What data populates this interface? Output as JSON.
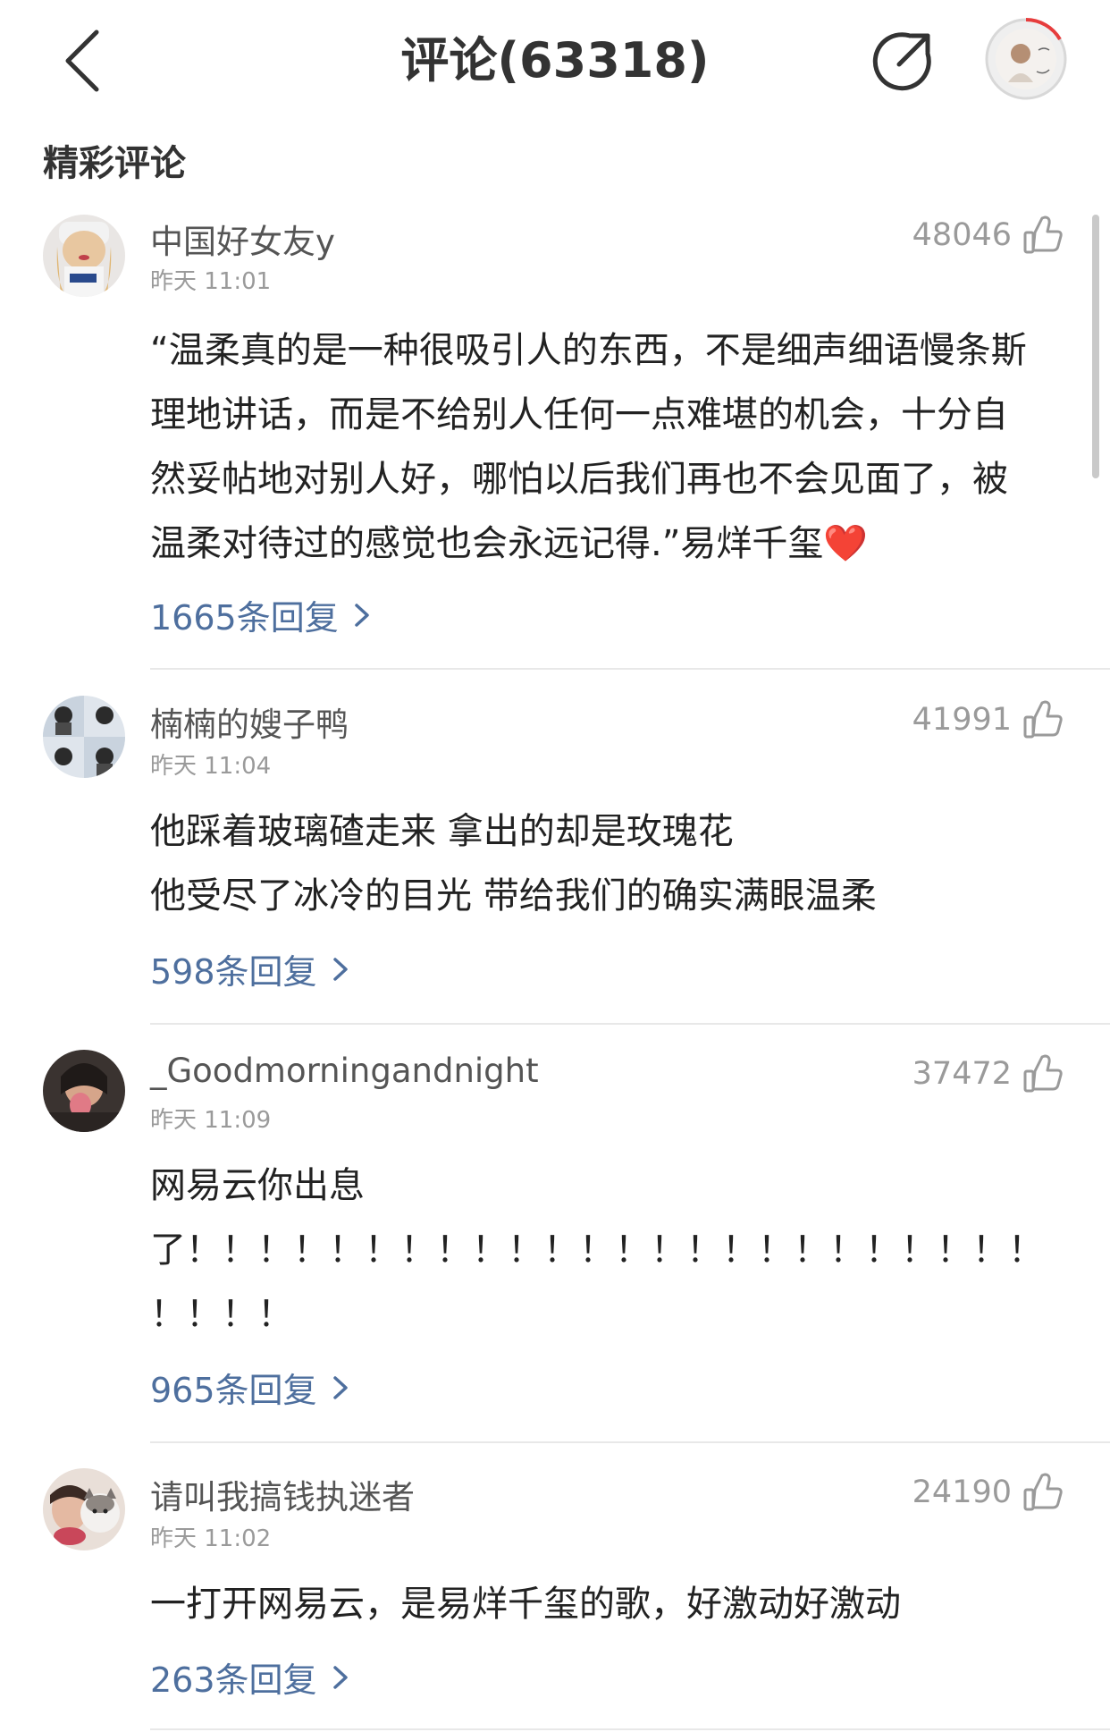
{
  "header": {
    "title": "评论(63318)",
    "back_icon": "chevron-left-icon",
    "share_icon": "share-icon",
    "avatar_icon": "user-avatar"
  },
  "section": {
    "title": "精彩评论"
  },
  "colors": {
    "accent_link": "#4e6f9e",
    "text": "#222222",
    "muted": "#9a9a9a",
    "playing_ring": "#e63d3d"
  },
  "comments": [
    {
      "username": "中国好女友y",
      "time": "昨天 11:01",
      "likes": "48046",
      "lines": [
        "“温柔真的是一种很吸引人的东西，不是细声细语慢条斯",
        "理地讲话，而是不给别人任何一点难堪的机会，十分自",
        "然妥帖地对别人好，哪怕以后我们再也不会见面了，被",
        "温柔对待过的感觉也会永远记得.”易烊千玺❤️"
      ],
      "replies": "1665条回复"
    },
    {
      "username": "楠楠的嫂子鸭",
      "time": "昨天 11:04",
      "likes": "41991",
      "lines": [
        "他踩着玻璃碴走来 拿出的却是玫瑰花",
        "他受尽了冰冷的目光 带给我们的确实满眼温柔"
      ],
      "replies": "598条回复"
    },
    {
      "username": "_Goodmorningandnight",
      "time": "昨天 11:09",
      "likes": "37472",
      "lines": [
        "网易云你出息",
        "了！！！！！！！！！！！！！！！！！！！！！！！！",
        "！！！！"
      ],
      "replies": "965条回复"
    },
    {
      "username": "请叫我搞钱执迷者",
      "time": "昨天 11:02",
      "likes": "24190",
      "lines": [
        "一打开网易云，是易烊千玺的歌，好激动好激动"
      ],
      "replies": "263条回复"
    }
  ]
}
